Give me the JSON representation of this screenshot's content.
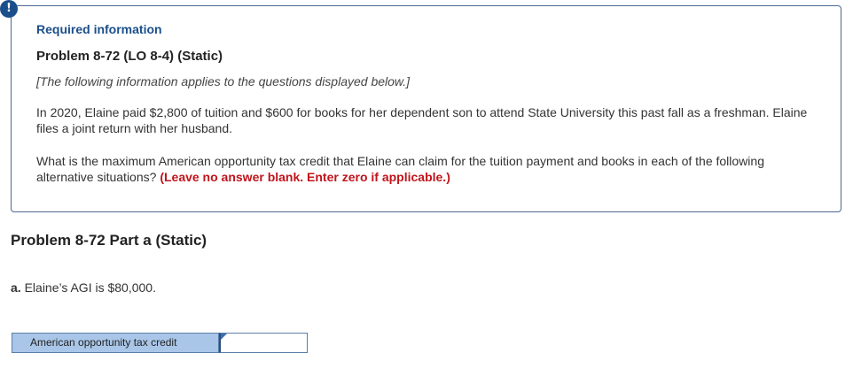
{
  "alert_badge": "!",
  "header": {
    "required_label": "Required information",
    "problem_title": "Problem 8-72 (LO 8-4) (Static)",
    "note": "[The following information applies to the questions displayed below.]"
  },
  "body": {
    "paragraph1": "In 2020, Elaine paid $2,800 of tuition and $600 for books for her dependent son to attend State University this past fall as a freshman. Elaine files a joint return with her husband.",
    "paragraph2": "What is the maximum American opportunity tax credit that Elaine can claim for the tuition payment and books in each of the following alternative situations?",
    "instruction": "(Leave no answer blank. Enter zero if applicable.)"
  },
  "part": {
    "heading": "Problem 8-72 Part a (Static)",
    "letter": "a.",
    "text": "Elaine’s AGI is $80,000."
  },
  "answer": {
    "label": "American opportunity tax credit",
    "value": ""
  },
  "colors": {
    "accent_blue": "#1a4f8b",
    "instruction_red": "#c0141b",
    "label_fill": "#a9c6e8"
  }
}
